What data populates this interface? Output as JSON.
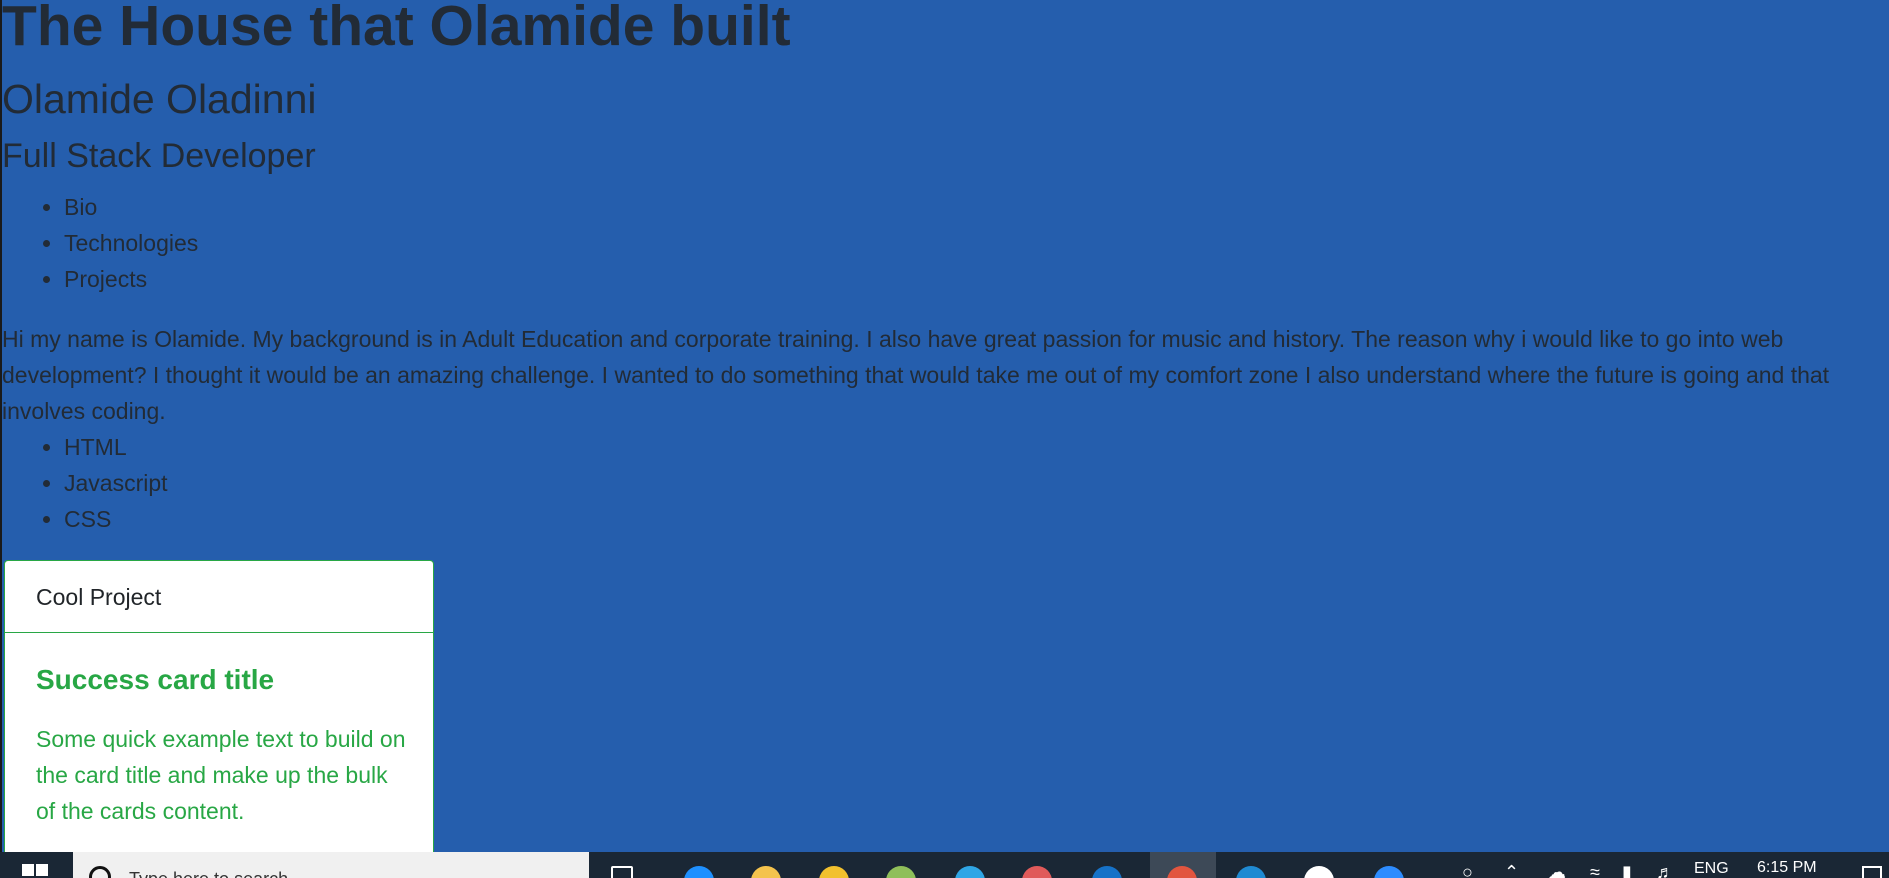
{
  "page": {
    "title": "The House that Olamide built",
    "name": "Olamide Oladinni",
    "role": "Full Stack Developer",
    "nav_items": [
      "Bio",
      "Technologies",
      "Projects"
    ],
    "bio": "Hi my name is Olamide. My background is in Adult Education and corporate training. I also have great passion for music and history. The reason why i would like to go into web development? I thought it would be an amazing challenge. I wanted to do something that would take me out of my comfort zone I also understand where the future is going and that involves coding.",
    "technologies": [
      "HTML",
      "Javascript",
      "CSS"
    ]
  },
  "card": {
    "header": "Cool Project",
    "title": "Success card title",
    "text": "Some quick example text to build on the card title and make up the bulk of the cards content."
  },
  "taskbar": {
    "search_placeholder": "Type here to search",
    "language": "ENG",
    "time": "6:15 PM",
    "apps": [
      {
        "icon": "task-view-icon",
        "color": "#ffffff"
      },
      {
        "icon": "edge-icon",
        "color": "#1e90ff"
      },
      {
        "icon": "file-explorer-icon",
        "color": "#f4c34d"
      },
      {
        "icon": "chrome-canary-icon",
        "color": "#f2c12e"
      },
      {
        "icon": "chrome-icon",
        "color": "#8fbf5a"
      },
      {
        "icon": "skype-icon",
        "color": "#2fa6e6"
      },
      {
        "icon": "paint-icon",
        "color": "#e05a5a"
      },
      {
        "icon": "outlook-icon",
        "color": "#1672c8"
      },
      {
        "icon": "chrome-active-icon",
        "color": "#e2553f"
      },
      {
        "icon": "vscode-icon",
        "color": "#1f8ad2"
      },
      {
        "icon": "slack-icon",
        "color": "#ffffff"
      },
      {
        "icon": "zoom-icon",
        "color": "#2d8cff"
      }
    ]
  },
  "colors": {
    "background": "#255ead",
    "text": "#222b36",
    "success": "#28a745",
    "taskbar": "#1a2735"
  }
}
